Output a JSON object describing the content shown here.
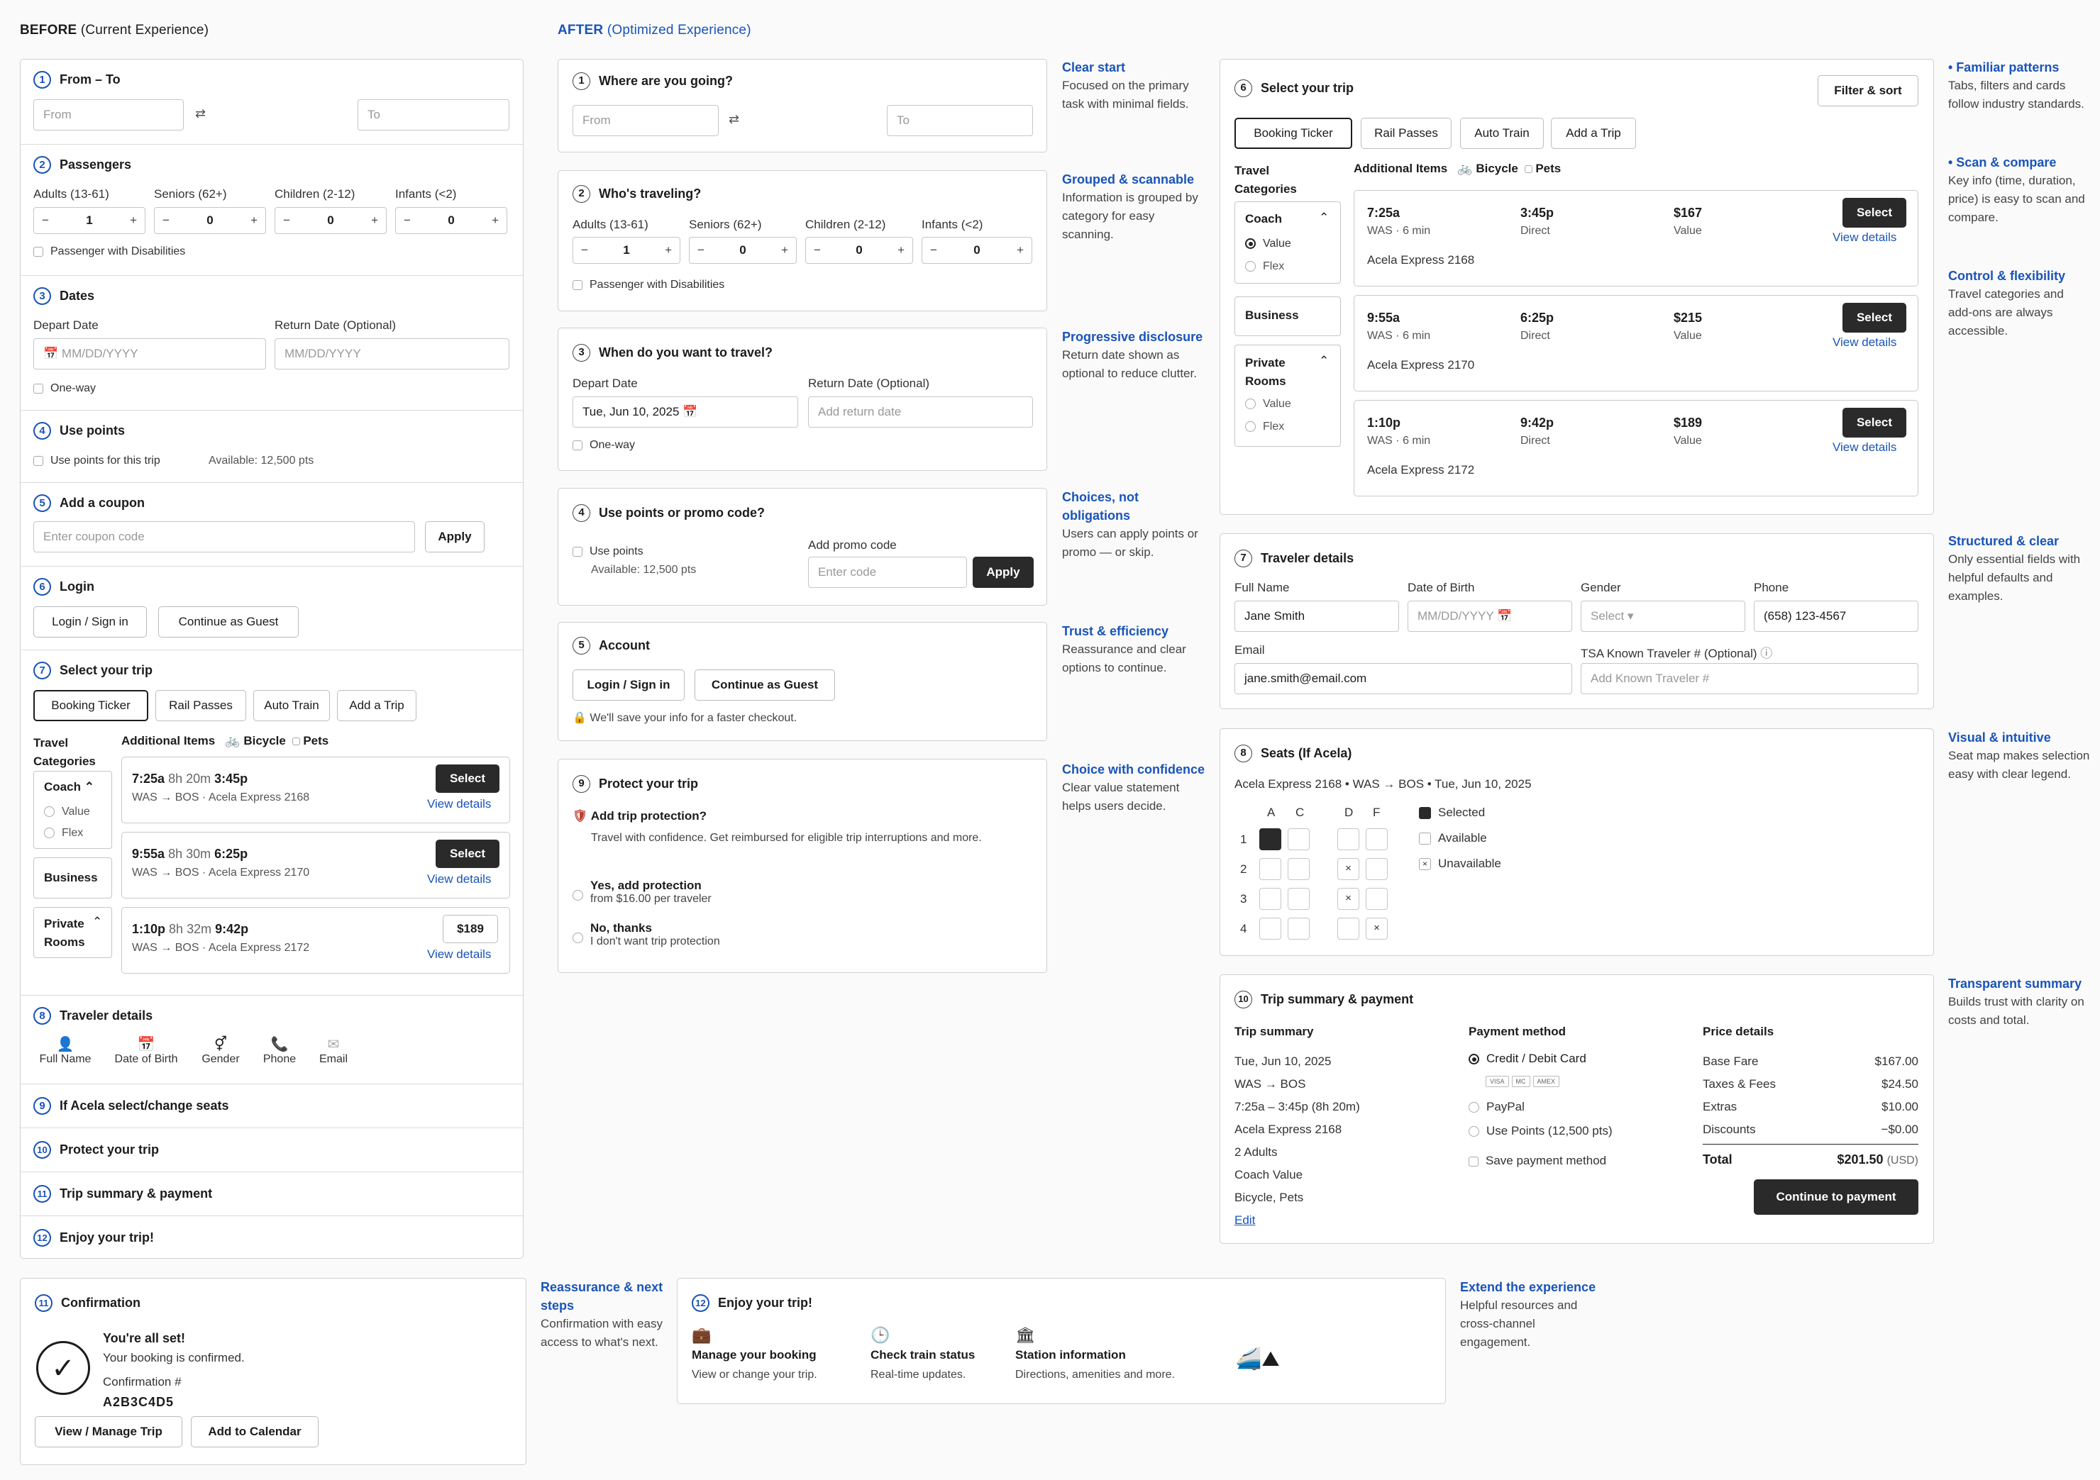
{
  "before": {
    "heading": "BEFORE",
    "heading_sub": "(Current Experience)",
    "s1": {
      "num": "1",
      "title": "From – To",
      "from_ph": "From",
      "to_ph": "To",
      "swap": "⇄"
    },
    "s2": {
      "num": "2",
      "title": "Passengers",
      "labels": [
        "Adults (13-61)",
        "Seniors (62+)",
        "Children (2-12)",
        "Infants (<2)"
      ],
      "values": [
        "1",
        "0",
        "0",
        "0"
      ],
      "disab": "Passenger with Disabilities"
    },
    "s3": {
      "num": "3",
      "title": "Dates",
      "depart": "Depart Date",
      "ret": "Return Date (Optional)",
      "ph": "MM/DD/YYYY",
      "oneway": "One-way"
    },
    "s4": {
      "num": "4",
      "title": "Use points",
      "chk": "Use points for this trip",
      "avail": "Available: 12,500 pts"
    },
    "s5": {
      "num": "5",
      "title": "Add a coupon",
      "ph": "Enter coupon code",
      "apply": "Apply"
    },
    "s6": {
      "num": "6",
      "title": "Login",
      "login": "Login / Sign in",
      "guest": "Continue as Guest"
    },
    "s7": {
      "num": "7",
      "title": "Select your trip",
      "tabs": [
        "Booking Ticker",
        "Rail Passes",
        "Auto Train",
        "Add a Trip"
      ],
      "cat_title": "Travel Categories",
      "addl": "Additional Items",
      "bike": "Bicycle",
      "pets": "Pets",
      "coach": "Coach",
      "value": "Value",
      "flex": "Flex",
      "business": "Business",
      "private": "Private Rooms",
      "trips": [
        {
          "dep": "7:25a",
          "dur": "8h 20m",
          "arr": "3:45p",
          "route": "WAS → BOS · Acela Express 2168",
          "btn": "Select",
          "link": "View details"
        },
        {
          "dep": "9:55a",
          "dur": "8h 30m",
          "arr": "6:25p",
          "route": "WAS → BOS · Acela Express 2170",
          "btn": "Select",
          "link": "View details"
        },
        {
          "dep": "1:10p",
          "dur": "8h 32m",
          "arr": "9:42p",
          "route": "WAS → BOS · Acela Express 2172",
          "btn": "$189",
          "link": "View details"
        }
      ]
    },
    "s8": {
      "num": "8",
      "title": "Traveler details",
      "items": [
        "Full Name",
        "Date of Birth",
        "Gender",
        "Phone",
        "Email"
      ]
    },
    "s9": {
      "num": "9",
      "title": "If Acela select/change seats"
    },
    "s10": {
      "num": "10",
      "title": "Protect your trip"
    },
    "s11": {
      "num": "11",
      "title": "Trip summary & payment"
    },
    "s12": {
      "num": "12",
      "title": "Enjoy your trip!"
    }
  },
  "after": {
    "heading": "AFTER",
    "heading_sub": "(Optimized Experience)",
    "a1": {
      "num": "1",
      "title": "Where are you going?",
      "from_ph": "From",
      "to_ph": "To",
      "swap": "⇄"
    },
    "a2": {
      "num": "2",
      "title": "Who's traveling?",
      "labels": [
        "Adults (13-61)",
        "Seniors (62+)",
        "Children (2-12)",
        "Infants (<2)"
      ],
      "values": [
        "1",
        "0",
        "0",
        "0"
      ],
      "disab": "Passenger with Disabilities"
    },
    "a3": {
      "num": "3",
      "title": "When do you want to travel?",
      "depart": "Depart Date",
      "depart_val": "Tue, Jun 10, 2025",
      "ret": "Return Date (Optional)",
      "ret_ph": "Add return date",
      "oneway": "One-way"
    },
    "a4": {
      "num": "4",
      "title": "Use points or promo code?",
      "chk": "Use points",
      "avail": "Available: 12,500 pts",
      "promo_lbl": "Add promo code",
      "promo_ph": "Enter code",
      "apply": "Apply"
    },
    "a5": {
      "num": "5",
      "title": "Account",
      "login": "Login / Sign in",
      "guest": "Continue as Guest",
      "note": "We'll save your info for a faster checkout."
    },
    "a9": {
      "num": "9",
      "title": "Protect your trip",
      "q": "Add trip protection?",
      "desc": "Travel with confidence. Get reimbursed for eligible trip interruptions and more.",
      "yes": "Yes, add protection",
      "yes_sub": "from $16.00 per traveler",
      "no": "No, thanks",
      "no_sub": "I don't want trip protection"
    },
    "a6": {
      "num": "6",
      "title": "Select your trip",
      "filter": "Filter & sort",
      "tabs": [
        "Booking Ticker",
        "Rail Passes",
        "Auto Train",
        "Add a Trip"
      ],
      "cat_title": "Travel Categories",
      "addl": "Additional Items",
      "bike": "Bicycle",
      "pets": "Pets",
      "coach": "Coach",
      "value": "Value",
      "flex": "Flex",
      "business": "Business",
      "private": "Private Rooms",
      "trips": [
        {
          "dep": "7:25a",
          "dep_sub": "WAS · 6 min",
          "arr": "3:45p",
          "arr_sub": "Direct",
          "price": "$167",
          "price_sub": "Value",
          "train": "Acela Express 2168",
          "btn": "Select",
          "link": "View details"
        },
        {
          "dep": "9:55a",
          "dep_sub": "WAS · 6 min",
          "arr": "6:25p",
          "arr_sub": "Direct",
          "price": "$215",
          "price_sub": "Value",
          "train": "Acela Express 2170",
          "btn": "Select",
          "link": "View details"
        },
        {
          "dep": "1:10p",
          "dep_sub": "WAS · 6 min",
          "arr": "9:42p",
          "arr_sub": "Direct",
          "price": "$189",
          "price_sub": "Value",
          "train": "Acela Express 2172",
          "btn": "Select",
          "link": "View details"
        }
      ]
    },
    "a7": {
      "num": "7",
      "title": "Traveler details",
      "name_lbl": "Full Name",
      "name_val": "Jane Smith",
      "dob_lbl": "Date of Birth",
      "dob_ph": "MM/DD/YYYY",
      "gender_lbl": "Gender",
      "gender_ph": "Select ▾",
      "phone_lbl": "Phone",
      "phone_val": "(658) 123-4567",
      "email_lbl": "Email",
      "email_val": "jane.smith@email.com",
      "tsa_lbl": "TSA Known Traveler # (Optional)",
      "tsa_ph": "Add Known Traveler #"
    },
    "a8": {
      "num": "8",
      "title": "Seats (If Acela)",
      "sub": "Acela Express 2168  •  WAS → BOS  •  Tue, Jun 10, 2025",
      "cols": [
        "A",
        "C",
        "D",
        "F"
      ],
      "rows": [
        "1",
        "2",
        "3",
        "4"
      ],
      "legend": [
        "Selected",
        "Available",
        "Unavailable"
      ]
    },
    "a10": {
      "num": "10",
      "title": "Trip summary & payment",
      "sum_title": "Trip summary",
      "summary": [
        "Tue, Jun 10, 2025",
        "WAS → BOS",
        "7:25a – 3:45p (8h 20m)",
        "Acela Express 2168",
        "2 Adults",
        "Coach Value",
        "Bicycle, Pets"
      ],
      "edit": "Edit",
      "pay_title": "Payment method",
      "pay": [
        "Credit / Debit Card",
        "PayPal",
        "Use Points (12,500 pts)"
      ],
      "cards": [
        "VISA",
        "MC",
        "AMEX"
      ],
      "save": "Save payment method",
      "price_title": "Price details",
      "prices": [
        [
          "Base Fare",
          "$167.00"
        ],
        [
          "Taxes & Fees",
          "$24.50"
        ],
        [
          "Extras",
          "$10.00"
        ],
        [
          "Discounts",
          "−$0.00"
        ]
      ],
      "total_lbl": "Total",
      "total_val": "$201.50",
      "currency": "(USD)",
      "cta": "Continue to payment"
    },
    "a11": {
      "num": "11",
      "title": "Confirmation",
      "h": "You're all set!",
      "msg": "Your booking is confirmed.",
      "conf_lbl": "Confirmation #",
      "conf": "A2B3C4D5",
      "manage": "View / Manage Trip",
      "cal": "Add to Calendar"
    },
    "a12": {
      "num": "12",
      "title": "Enjoy your trip!",
      "items": [
        [
          "Manage your booking",
          "View or change your trip."
        ],
        [
          "Check train status",
          "Real-time updates."
        ],
        [
          "Station information",
          "Directions, amenities and more."
        ]
      ]
    }
  },
  "annotations": {
    "mid": [
      {
        "h": "Clear start",
        "b": "Focused on the primary task with minimal fields."
      },
      {
        "h": "Grouped & scannable",
        "b": "Information is grouped by category for easy scanning."
      },
      {
        "h": "Progressive disclosure",
        "b": "Return date shown as optional to reduce clutter."
      },
      {
        "h": "Choices, not obligations",
        "b": "Users can apply points or promo — or skip."
      },
      {
        "h": "Trust & efficiency",
        "b": "Reassurance and clear options to continue."
      },
      {
        "h": "Choice with confidence",
        "b": "Clear value statement helps users decide."
      }
    ],
    "right": [
      {
        "h": "• Familiar patterns",
        "b": "Tabs, filters and cards follow industry standards."
      },
      {
        "h": "• Scan & compare",
        "b": "Key info (time, duration, price) is easy to scan and compare."
      },
      {
        "h": "Control & flexibility",
        "b": "Travel categories and add-ons are always accessible."
      },
      {
        "h": "Structured & clear",
        "b": "Only essential fields with helpful defaults and examples."
      },
      {
        "h": "Visual & intuitive",
        "b": "Seat map makes selection easy with clear legend."
      },
      {
        "h": "Transparent summary",
        "b": "Builds trust with clarity on costs and total."
      }
    ],
    "bottom": [
      {
        "h": "Reassurance & next steps",
        "b": "Confirmation with easy access to what's next."
      },
      {
        "h": "Extend the experience",
        "b": "Helpful resources and cross-channel engagement."
      }
    ]
  }
}
